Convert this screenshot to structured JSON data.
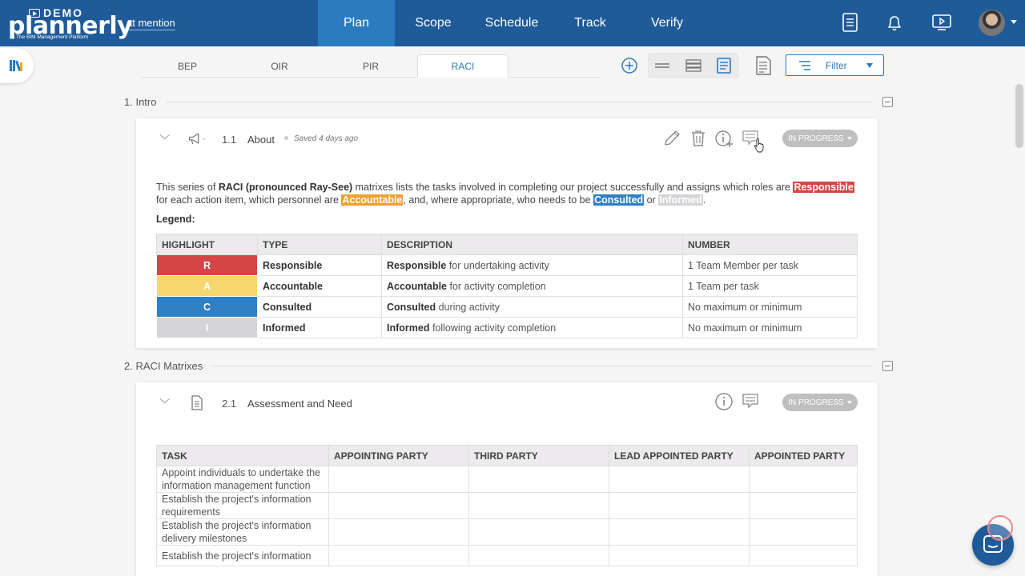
{
  "header": {
    "logo_demo": "DEMO",
    "logo_brand": "plannerly",
    "logo_tagline": "The BIM Management Platform",
    "project_name": "at mention",
    "nav": [
      "Plan",
      "Scope",
      "Schedule",
      "Track",
      "Verify"
    ],
    "active_nav": "Plan"
  },
  "tabs": {
    "items": [
      "BEP",
      "OIR",
      "PIR",
      "RACI"
    ],
    "active": "RACI"
  },
  "toolbar": {
    "filter_label": "Filter"
  },
  "sections": [
    {
      "title": "1. Intro",
      "cards": [
        {
          "number": "1.1",
          "title": "About",
          "saved": "Saved 4 days ago",
          "status": "IN PROGRESS",
          "intro": {
            "p1": "This series of ",
            "b1": "RACI (pronounced Ray-See)",
            "p2": " matrixes lists the tasks involved in completing our project successfully and assigns which roles are ",
            "hl_r": "Responsible",
            "p3": " for each action item, which personnel are ",
            "hl_a": "Accountable",
            "p4": ", and, where appropriate, who needs to be ",
            "hl_c": "Consulted",
            "p5": " or ",
            "hl_i": "Informed",
            "p6": "."
          },
          "legend_label": "Legend:",
          "legend_headers": [
            "HIGHLIGHT",
            "TYPE",
            "DESCRIPTION",
            "NUMBER"
          ],
          "legend_rows": [
            {
              "letter": "R",
              "color": "#d64545",
              "type": "Responsible",
              "desc_bold": "Responsible",
              "desc_rest": " for undertaking activity",
              "number": "1 Team Member per task"
            },
            {
              "letter": "A",
              "color": "#f5d76e",
              "type": "Accountable",
              "desc_bold": "Accountable",
              "desc_rest": " for activity completion",
              "number": "1 Team per task"
            },
            {
              "letter": "C",
              "color": "#2e7fc4",
              "type": "Consulted",
              "desc_bold": "Consulted",
              "desc_rest": " during activity",
              "number": "No maximum or minimum"
            },
            {
              "letter": "I",
              "color": "#d4d4d8",
              "type": "Informed",
              "desc_bold": "Informed",
              "desc_rest": " following activity completion",
              "number": "No maximum or minimum"
            }
          ]
        }
      ]
    },
    {
      "title": "2. RACI Matrixes",
      "cards": [
        {
          "number": "2.1",
          "title": "Assessment and Need",
          "status": "IN PROGRESS",
          "headers": [
            "TASK",
            "APPOINTING PARTY",
            "THIRD PARTY",
            "LEAD APPOINTED PARTY",
            "APPOINTED PARTY"
          ],
          "rows": [
            "Appoint individuals to undertake the information management function",
            "Establish the project's information requirements",
            "Establish the project's information delivery milestones",
            "Establish the project's information"
          ]
        }
      ]
    }
  ],
  "colors": {
    "header_bg": "#1f5a99",
    "accent": "#2b7bc0",
    "responsible": "#d64545",
    "accountable": "#f0a030",
    "consulted": "#2e7fc4",
    "informed": "#d4d4d8"
  }
}
